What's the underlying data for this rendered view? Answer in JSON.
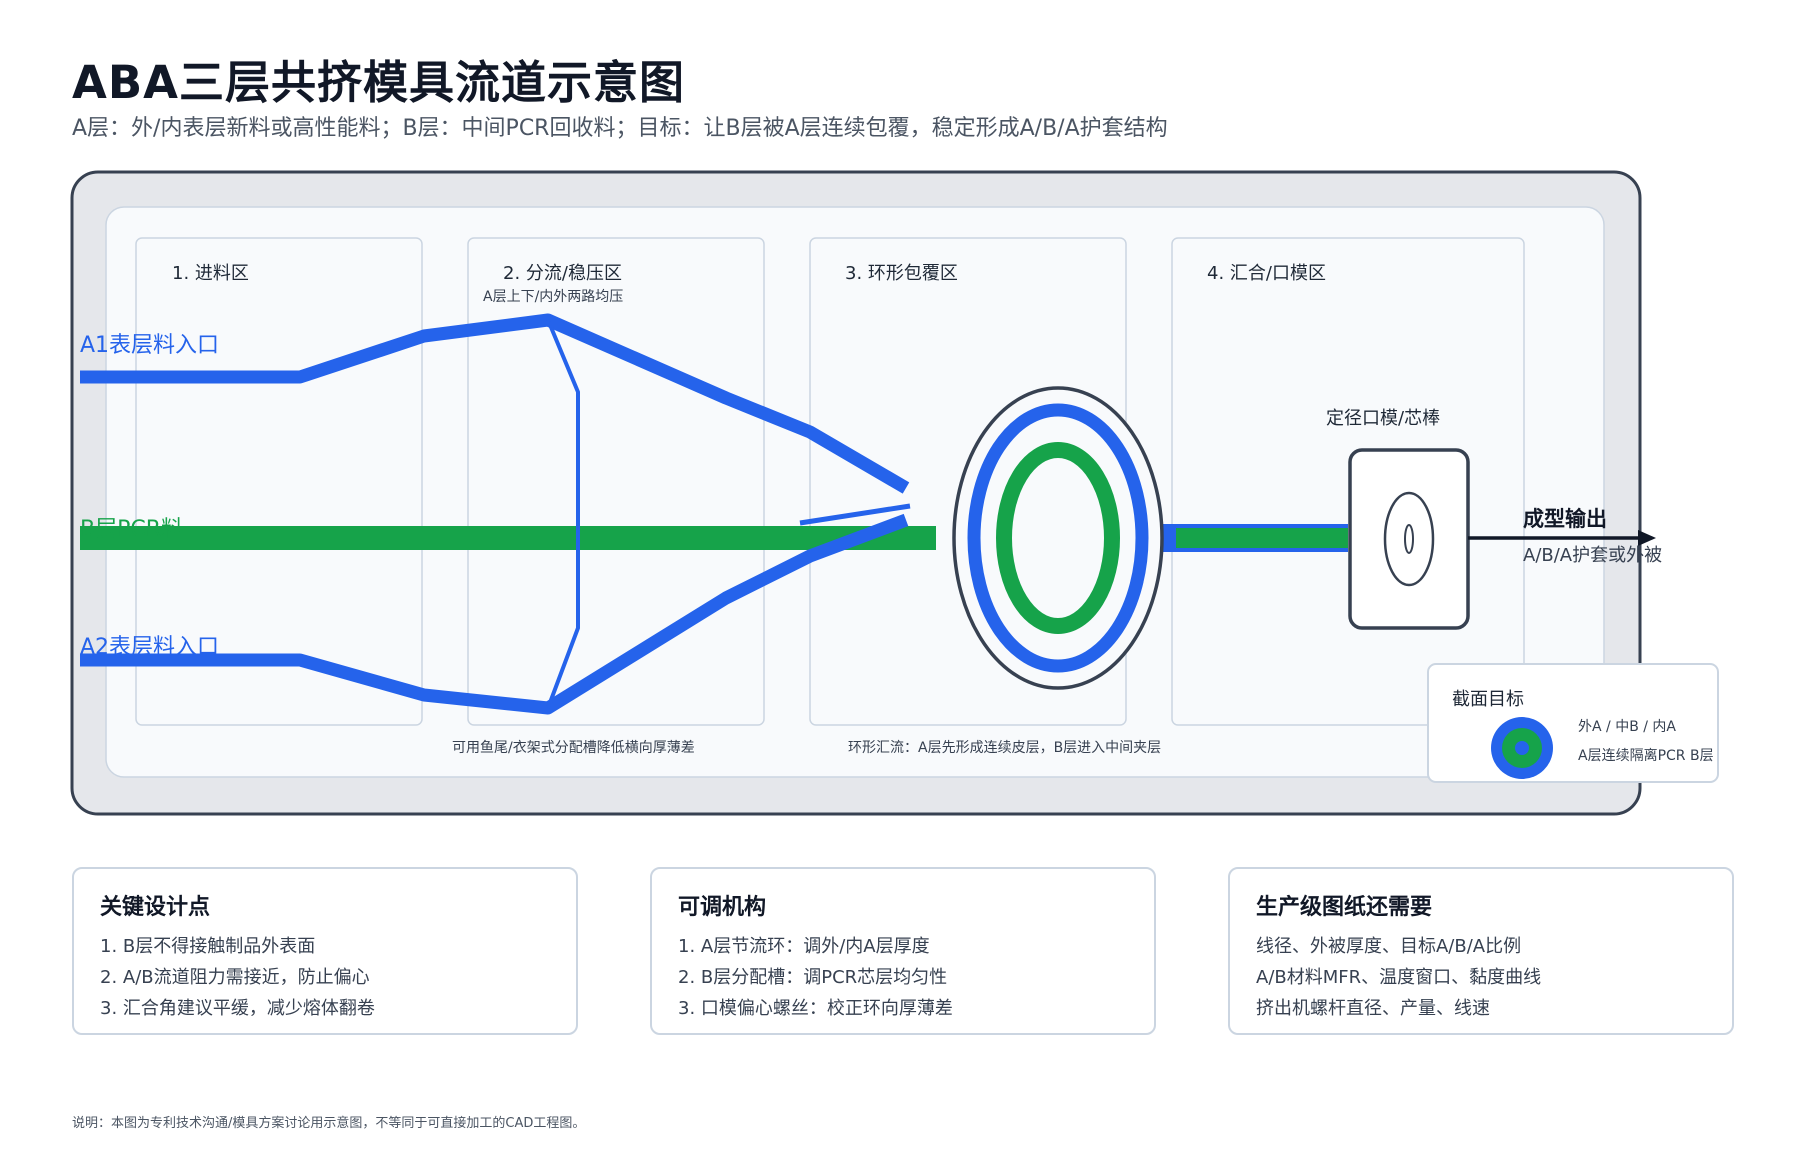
{
  "title": "ABA三层共挤模具流道示意图",
  "subtitle": "A层：外/内表层新料或高性能料；B层：中间PCR回收料；目标：让B层被A层连续包覆，稳定形成A/B/A护套结构",
  "zones": [
    {
      "label": "1. 进料区"
    },
    {
      "label": "2. 分流/稳压区",
      "sub": "A层上下/内外两路均压"
    },
    {
      "label": "3. 环形包覆区"
    },
    {
      "label": "4. 汇合/口模区"
    }
  ],
  "inlets": {
    "a1": "A1表层料入口",
    "b": "B层PCR料",
    "a2": "A2表层料入口"
  },
  "notes": {
    "distribution": "可用鱼尾/衣架式分配槽降低横向厚薄差",
    "annular": "环形汇流：A层先形成连续皮层，B层进入中间夹层"
  },
  "die": {
    "label": "定径口模/芯棒"
  },
  "output": {
    "title": "成型输出",
    "sub": "A/B/A护套或外被"
  },
  "legend": {
    "title": "截面目标",
    "line1": "外A / 中B / 内A",
    "line2": "A层连续隔离PCR B层"
  },
  "colors": {
    "a_layer": "#2563eb",
    "b_layer": "#16a34a",
    "frame": "#374151",
    "panel_fill": "#f8fafc",
    "outer_fill": "#e5e7eb"
  },
  "cards": [
    {
      "title": "关键设计点",
      "lines": [
        "1. B层不得接触制品外表面",
        "2. A/B流道阻力需接近，防止偏心",
        "3. 汇合角建议平缓，减少熔体翻卷"
      ]
    },
    {
      "title": "可调机构",
      "lines": [
        "1. A层节流环：调外/内A层厚度",
        "2. B层分配槽：调PCR芯层均匀性",
        "3. 口模偏心螺丝：校正环向厚薄差"
      ]
    },
    {
      "title": "生产级图纸还需要",
      "lines": [
        "线径、外被厚度、目标A/B/A比例",
        "A/B材料MFR、温度窗口、黏度曲线",
        "挤出机螺杆直径、产量、线速"
      ]
    }
  ],
  "footnote": "说明：本图为专利技术沟通/模具方案讨论用示意图，不等同于可直接加工的CAD工程图。"
}
